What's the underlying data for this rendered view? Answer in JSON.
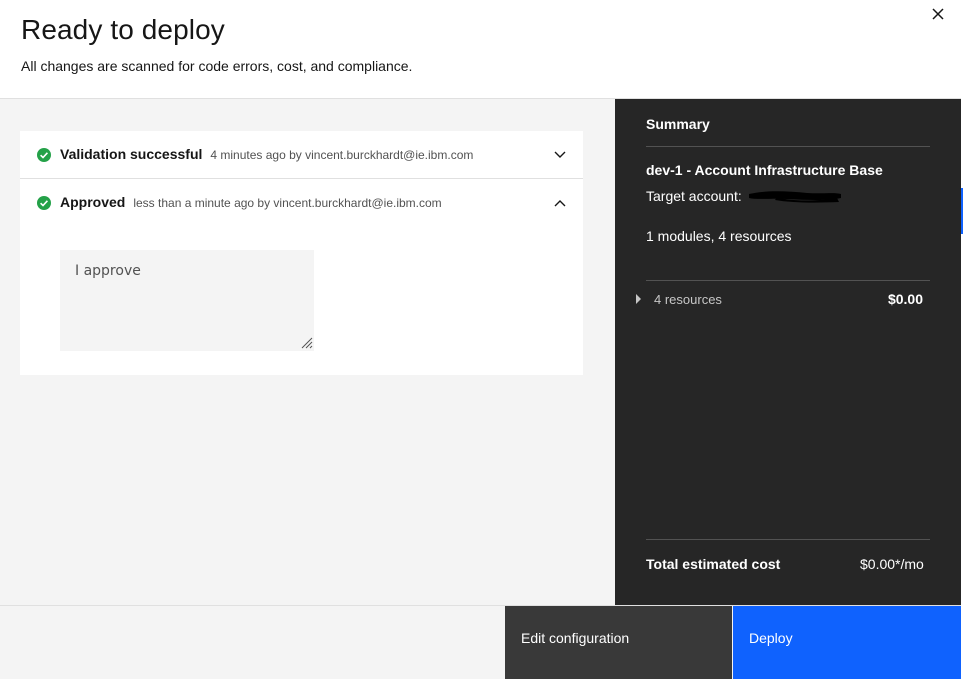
{
  "header": {
    "title": "Ready to deploy",
    "subtitle": "All changes are scanned for code errors, cost, and compliance."
  },
  "icons": {
    "close": "close-icon",
    "success": "checkmark-filled-icon",
    "expand": "chevron-down-icon",
    "collapse": "chevron-up-icon",
    "caret": "caret-right-icon"
  },
  "colors": {
    "success": "#24a148",
    "primary": "#0f62fe",
    "secondary": "#393939",
    "summary_bg": "#262626"
  },
  "accordion": {
    "items": [
      {
        "title": "Validation successful",
        "meta": "4 minutes ago by vincent.burckhardt@ie.ibm.com",
        "expanded": false
      },
      {
        "title": "Approved",
        "meta": "less than a minute ago by vincent.burckhardt@ie.ibm.com",
        "expanded": true
      }
    ],
    "comment_value": "I approve"
  },
  "summary": {
    "title": "Summary",
    "environment": "dev-1 - Account Infrastructure Base",
    "target_label": "Target account:",
    "counts": "1 modules, 4 resources",
    "resources_label": "4 resources",
    "resources_cost": "$0.00",
    "total_label": "Total estimated cost",
    "total_cost": "$0.00*/mo"
  },
  "footer": {
    "secondary_label": "Edit configuration",
    "primary_label": "Deploy"
  }
}
